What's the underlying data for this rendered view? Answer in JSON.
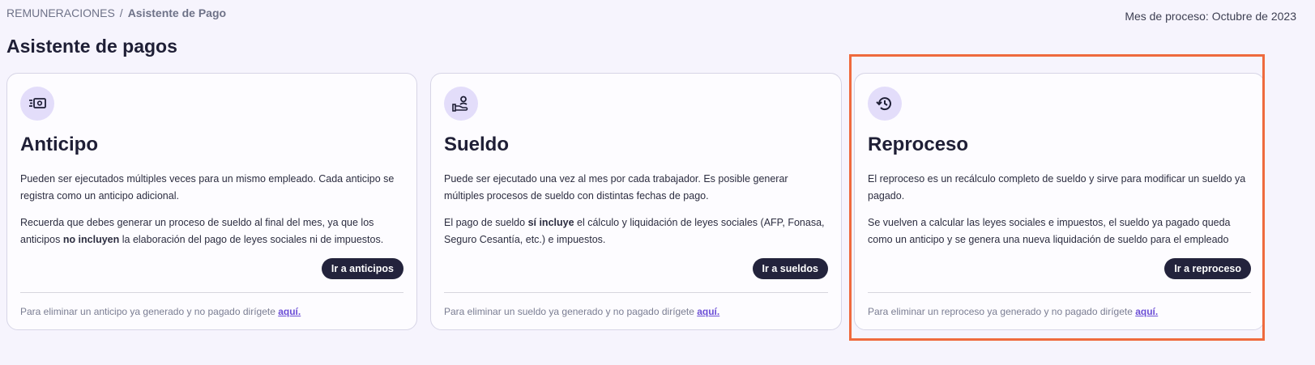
{
  "breadcrumb": {
    "parent": "REMUNERACIONES",
    "separator": "/",
    "current": "Asistente de Pago"
  },
  "month": "Mes de proceso: Octubre de 2023",
  "page_title": "Asistente de pagos",
  "cards": [
    {
      "icon": "cash-icon",
      "title": "Anticipo",
      "p1": "Pueden ser ejecutados múltiples veces para un mismo empleado. Cada anticipo se registra como un anticipo adicional.",
      "p2_before": "Recuerda que debes generar un proceso de sueldo al final del mes, ya que los anticipos ",
      "p2_bold": "no incluyen",
      "p2_after": " la elaboración del pago de leyes sociales ni de impuestos.",
      "button": "Ir a anticipos",
      "footer_text": "Para eliminar un anticipo ya generado y no pagado dirígete ",
      "footer_link": "aquí."
    },
    {
      "icon": "hand-user-icon",
      "title": "Sueldo",
      "p1": "Puede ser ejecutado una vez al mes por cada trabajador. Es posible generar múltiples procesos de sueldo con distintas fechas de pago.",
      "p2_before": "El pago de sueldo ",
      "p2_bold": "sí incluye",
      "p2_after": " el cálculo y liquidación de leyes sociales (AFP, Fonasa, Seguro Cesantía, etc.) e impuestos.",
      "button": "Ir a sueldos",
      "footer_text": "Para eliminar un sueldo ya generado y no pagado dirígete ",
      "footer_link": "aquí."
    },
    {
      "icon": "history-icon",
      "title": "Reproceso",
      "p1": "El reproceso es un recálculo completo de sueldo y sirve para modificar un sueldo ya pagado.",
      "p2_before": "Se vuelven a calcular las leyes sociales e impuestos, el sueldo ya pagado queda como un anticipo y se genera una nueva liquidación de sueldo para el empleado",
      "p2_bold": "",
      "p2_after": "",
      "button": "Ir a reproceso",
      "footer_text": "Para eliminar un reproceso ya generado y no pagado dirígete ",
      "footer_link": "aquí."
    }
  ],
  "colors": {
    "background": "#f6f4fd",
    "accent": "#6c4fd6",
    "button": "#23233c",
    "highlight": "#ef6a3d",
    "icon_bg": "#e3ddfa"
  }
}
